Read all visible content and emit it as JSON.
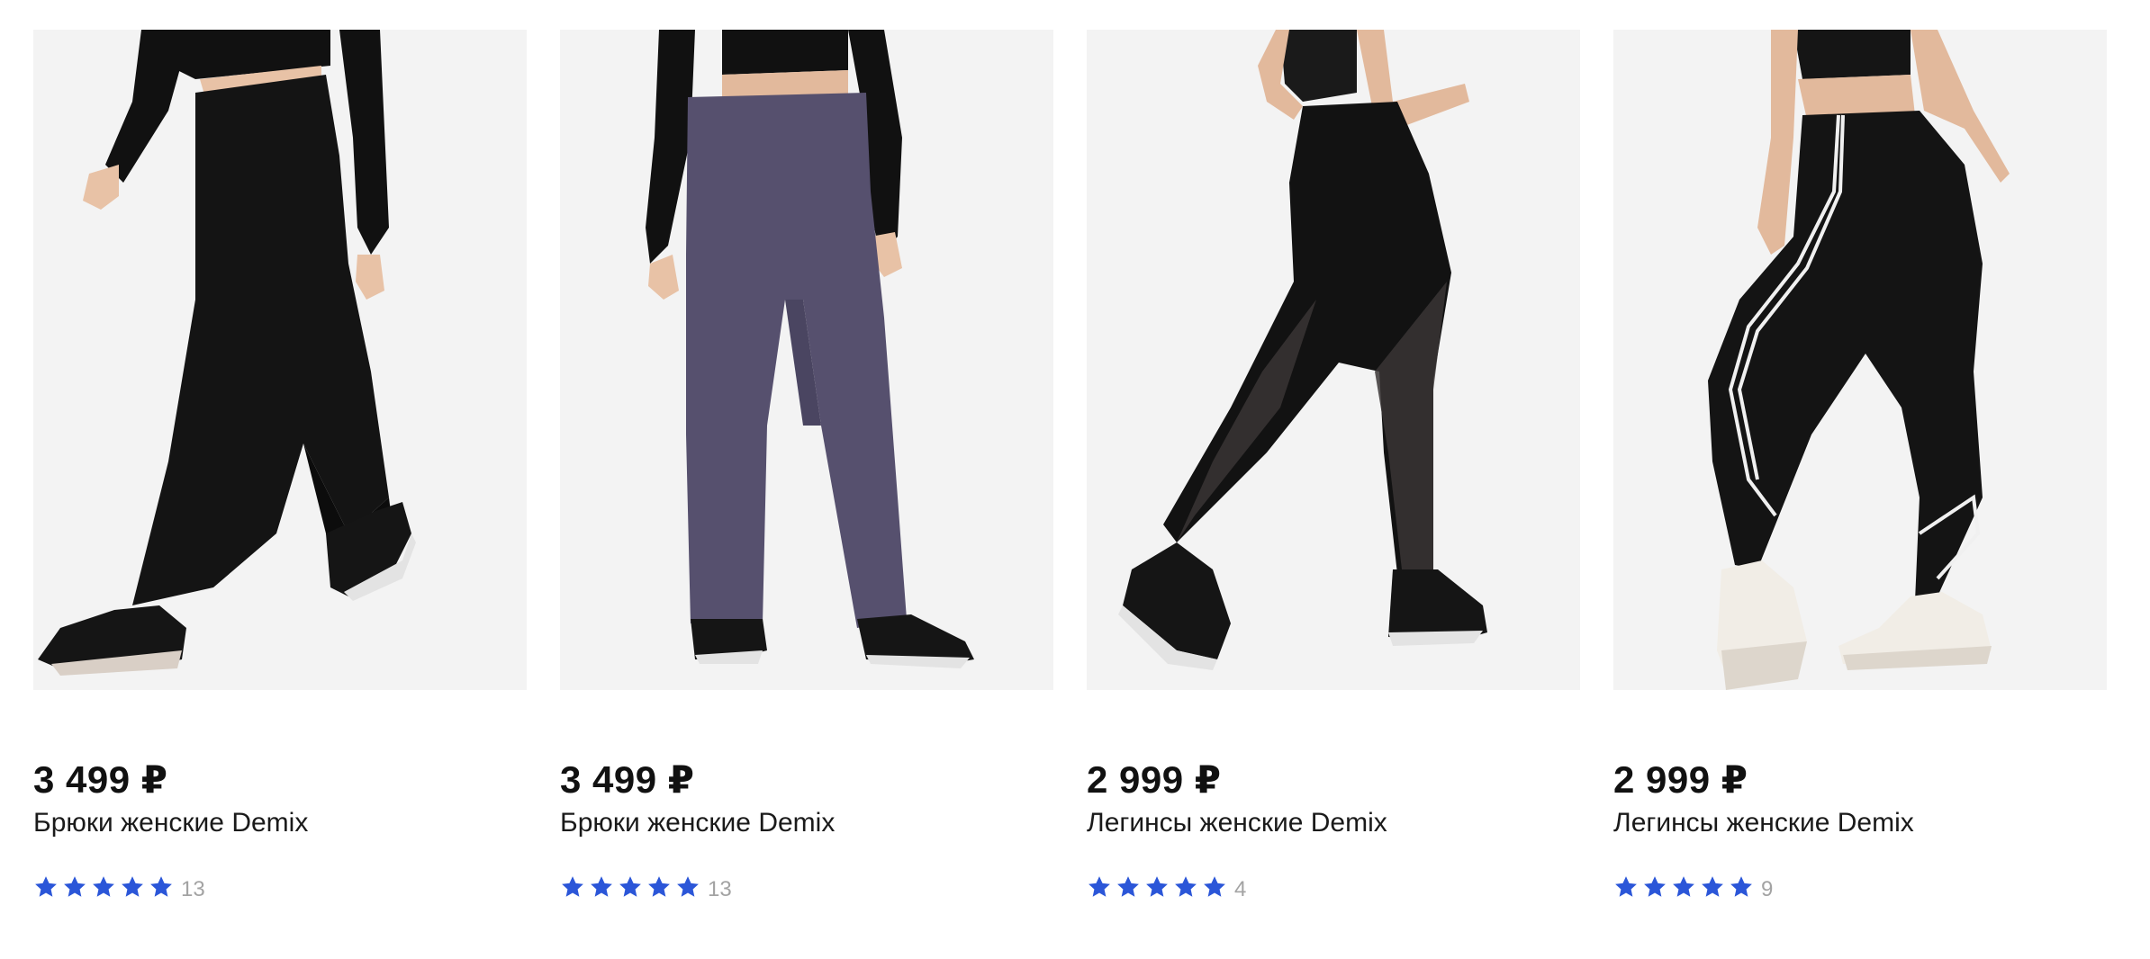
{
  "products": [
    {
      "price": "3 499 ₽",
      "title": "Брюки женские Demix",
      "rating": 5,
      "reviews": "13",
      "image_icon": "product-photo-black-wide-pants"
    },
    {
      "price": "3 499 ₽",
      "title": "Брюки женские Demix",
      "rating": 5,
      "reviews": "13",
      "image_icon": "product-photo-purple-wide-pants"
    },
    {
      "price": "2 999 ₽",
      "title": "Легинсы женские Demix",
      "rating": 5,
      "reviews": "4",
      "image_icon": "product-photo-black-mesh-leggings"
    },
    {
      "price": "2 999 ₽",
      "title": "Легинсы женские Demix",
      "rating": 5,
      "reviews": "9",
      "image_icon": "product-photo-black-piped-leggings"
    }
  ],
  "colors": {
    "star": "#2b56d8",
    "photo_bg": "#f3f3f3",
    "count": "#a3a3a3"
  }
}
